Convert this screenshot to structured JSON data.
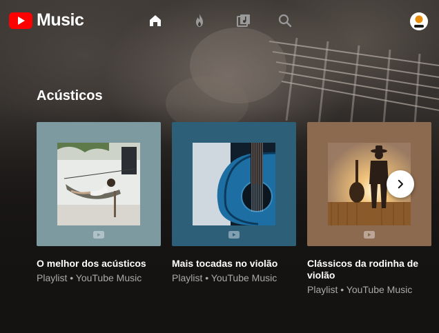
{
  "app": {
    "logo_text": "Music"
  },
  "nav": {
    "items": [
      {
        "name": "home-icon",
        "active": true
      },
      {
        "name": "fire-icon",
        "active": false
      },
      {
        "name": "library-icon",
        "active": false
      },
      {
        "name": "search-icon",
        "active": false
      }
    ]
  },
  "section": {
    "title": "Acústicos"
  },
  "cards": [
    {
      "title": "O melhor dos acústicos",
      "subtitle": "Playlist • YouTube Music",
      "bg": "#7c9aa0"
    },
    {
      "title": "Mais tocadas no violão",
      "subtitle": "Playlist • YouTube Music",
      "bg": "#2e5f78"
    },
    {
      "title": "Clássicos da rodinha de violão",
      "subtitle": "Playlist • YouTube Music",
      "bg": "#8c6a50"
    }
  ],
  "colors": {
    "brand_red": "#ff0000",
    "subtitle_gray": "#aaaaaa"
  }
}
